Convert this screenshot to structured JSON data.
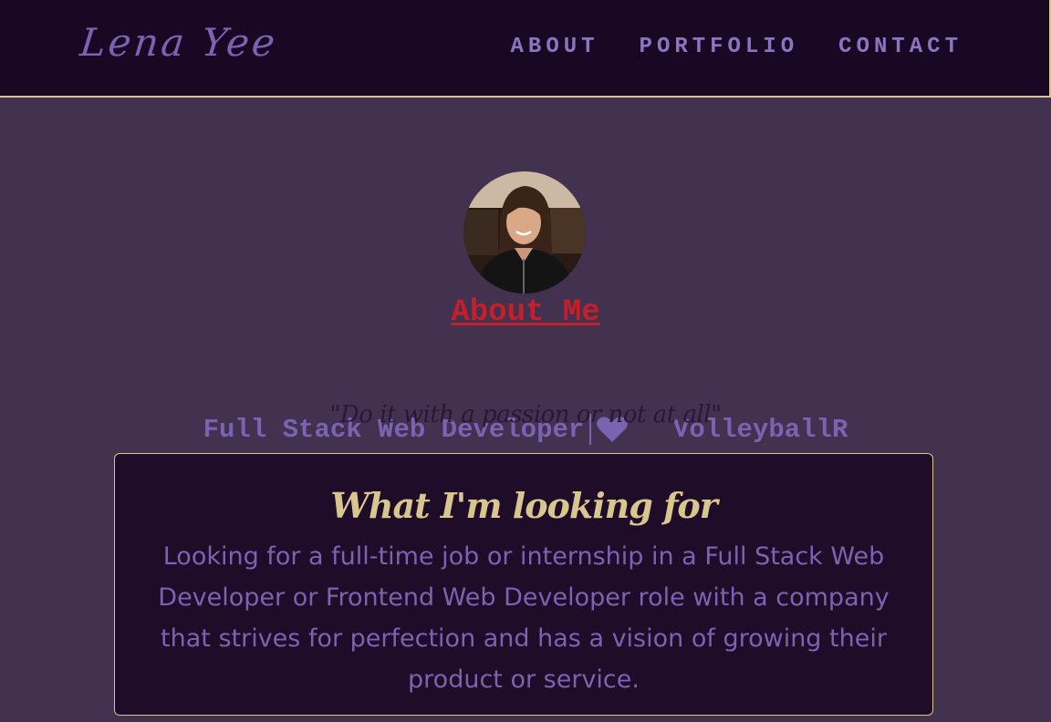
{
  "nav": {
    "brand": "Lena Yee",
    "links": [
      {
        "label": "ABOUT"
      },
      {
        "label": "PORTFOLIO"
      },
      {
        "label": "CONTACT"
      }
    ]
  },
  "hero": {
    "about_title": "About Me",
    "tagline_left": "Full Stack Web Developer",
    "tagline_right": "VolleyballR",
    "heart_icon": "heart-icon",
    "quote": "\"Do it with a passion or not at all\""
  },
  "card": {
    "title": "What I'm looking for",
    "body": "Looking for a full-time job or internship in a Full Stack Web Developer or Frontend Web Developer role with a company that strives for perfection and has a vision of growing their product or service."
  },
  "colors": {
    "page_bg": "#433150",
    "nav_bg": "#190823",
    "accent_gold": "#d8c68e",
    "accent_purple": "#7a63b0",
    "about_red": "#c81e28"
  }
}
